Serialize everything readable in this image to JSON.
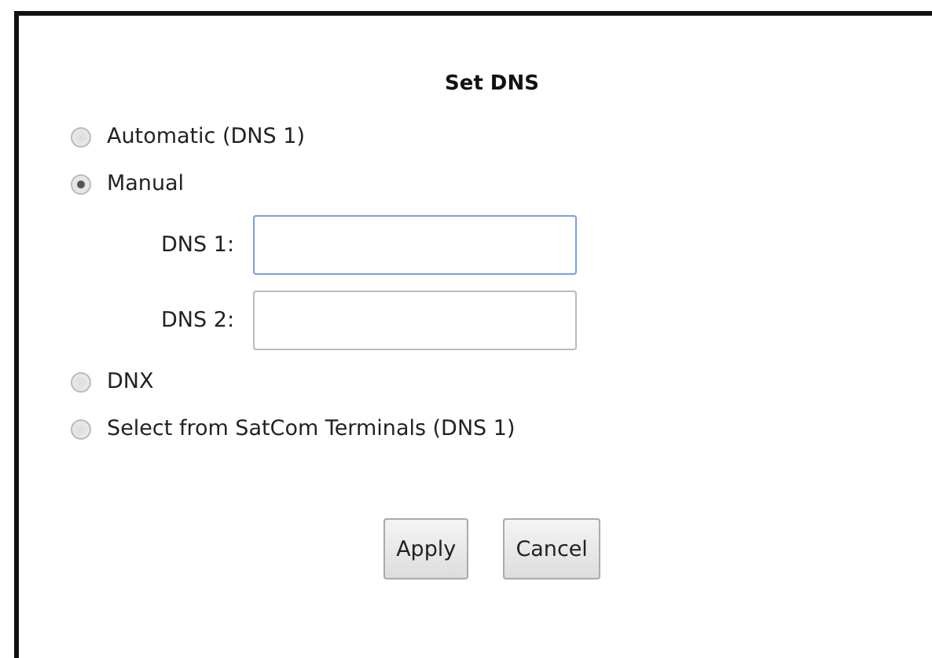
{
  "title": "Set DNS",
  "options": [
    {
      "label": "Automatic (DNS 1)",
      "selected": false
    },
    {
      "label": "Manual",
      "selected": true,
      "fields": [
        {
          "label": "DNS 1:",
          "focused": true
        },
        {
          "label": "DNS 2:",
          "focused": false
        }
      ]
    },
    {
      "label": "DNX",
      "selected": false
    },
    {
      "label": "Select from SatCom Terminals (DNS 1)",
      "selected": false
    }
  ],
  "buttons": [
    "Apply",
    "Cancel"
  ]
}
